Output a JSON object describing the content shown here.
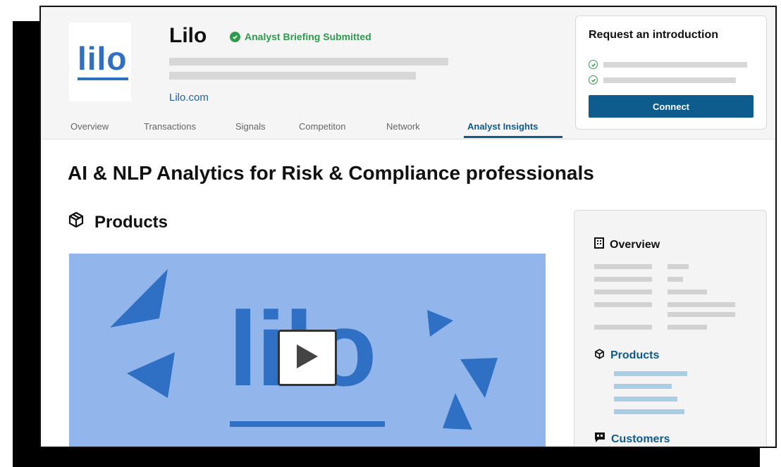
{
  "company": {
    "logo_text": "lilo",
    "name": "Lilo",
    "badge": "Analyst Briefing Submitted",
    "website": "Lilo.com"
  },
  "tabs": [
    "Overview",
    "Transactions",
    "Signals",
    "Competiton",
    "Network",
    "Analyst Insights"
  ],
  "active_tab": "Analyst Insights",
  "intro_card": {
    "title": "Request an introduction",
    "button_label": "Connect"
  },
  "headline": "AI & NLP Analytics for Risk & Compliance professionals",
  "products_section": {
    "title": "Products",
    "video_logo_text": "lilo"
  },
  "sidebar": {
    "overview_label": "Overview",
    "products_label": "Products",
    "customers_label": "Customers"
  },
  "colors": {
    "brand_blue": "#2f70c4",
    "primary": "#0e5b8e",
    "success": "#2e9a4e",
    "video_bg": "#92b6eb"
  }
}
